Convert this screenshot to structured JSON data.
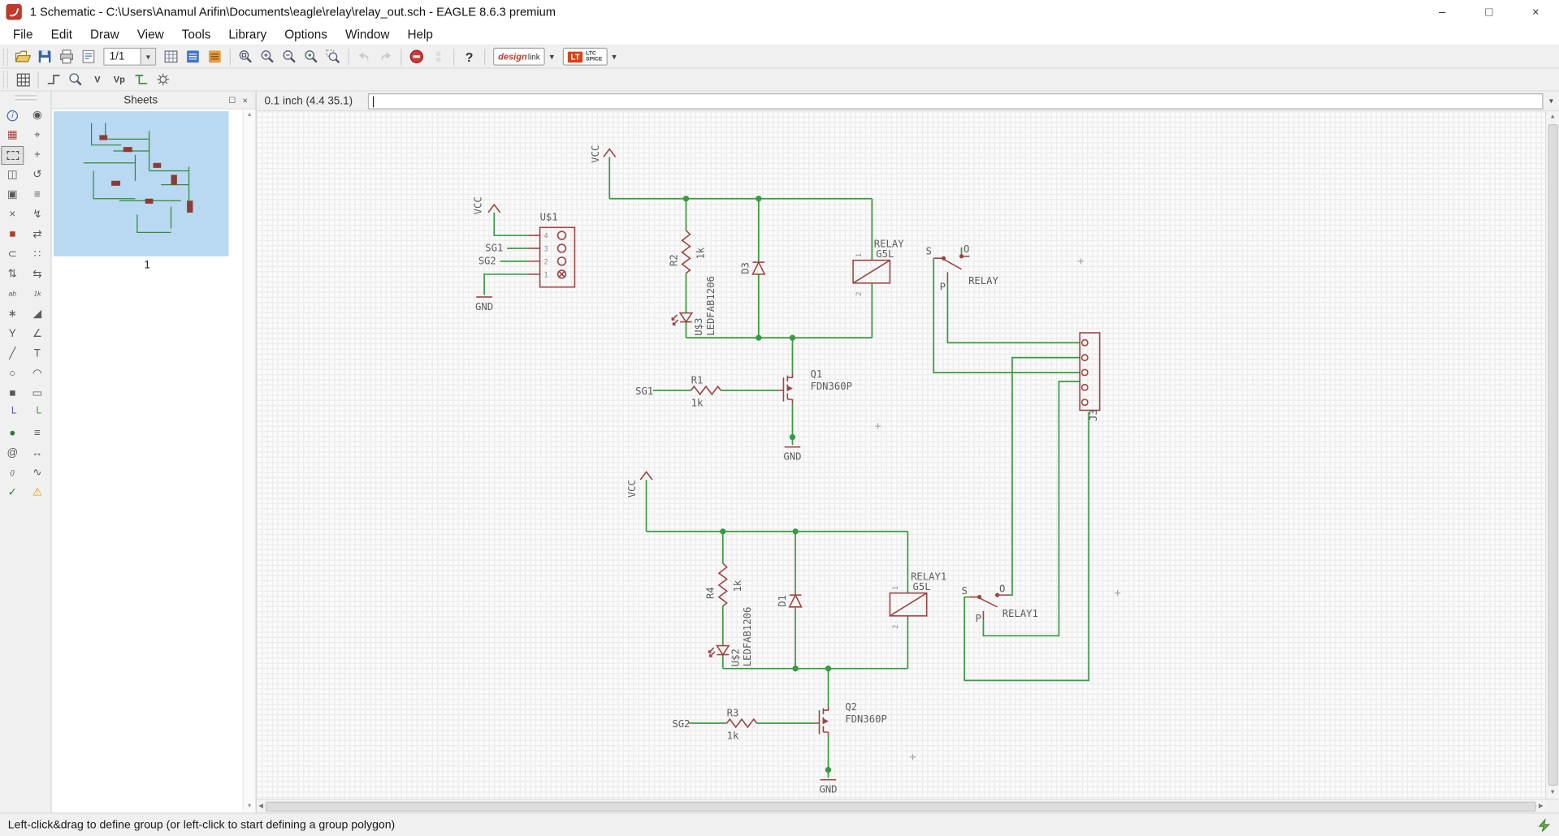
{
  "window": {
    "title": "1 Schematic - C:\\Users\\Anamul Arifin\\Documents\\eagle\\relay\\relay_out.sch - EAGLE 8.6.3 premium",
    "minimize": "–",
    "maximize": "□",
    "close": "×"
  },
  "menubar": {
    "items": [
      "File",
      "Edit",
      "Draw",
      "View",
      "Tools",
      "Library",
      "Options",
      "Window",
      "Help"
    ]
  },
  "toolbar1": {
    "zoom_level": "1/1",
    "dropdown_glyph": "▾",
    "help_glyph": "?",
    "designlink_line1": "design",
    "designlink_line2": "link",
    "ltspice_logo": "LT",
    "ltspice_line1": "LTC",
    "ltspice_line2": "SPICE"
  },
  "toolbar2": {
    "v_label": "V",
    "vp_label": "Vp"
  },
  "palette": {
    "icons": [
      {
        "name": "info",
        "glyph": "i",
        "css": "circled"
      },
      {
        "name": "show",
        "glyph": "◉"
      },
      {
        "name": "display",
        "glyph": "▦",
        "color": "#a8453f"
      },
      {
        "name": "mark",
        "glyph": "⌖"
      },
      {
        "name": "group",
        "glyph": "",
        "css": "dashedbox",
        "selected": true
      },
      {
        "name": "move",
        "glyph": "+"
      },
      {
        "name": "mirror",
        "glyph": "◫"
      },
      {
        "name": "rotate",
        "glyph": "↺"
      },
      {
        "name": "copy",
        "glyph": "▣"
      },
      {
        "name": "paste",
        "glyph": "≡"
      },
      {
        "name": "delete",
        "glyph": "×"
      },
      {
        "name": "change",
        "glyph": "↯"
      },
      {
        "name": "paint",
        "glyph": "■",
        "color": "#b23b32"
      },
      {
        "name": "replace",
        "glyph": "⇄"
      },
      {
        "name": "cut",
        "glyph": "⊂"
      },
      {
        "name": "invoke",
        "glyph": "∷"
      },
      {
        "name": "gateswap",
        "glyph": "⇅"
      },
      {
        "name": "pinswap",
        "glyph": "⇆"
      },
      {
        "name": "name",
        "glyph": "ab",
        "css": "nametag"
      },
      {
        "name": "value",
        "glyph": "1k",
        "css": "nametag"
      },
      {
        "name": "smash",
        "glyph": "∗"
      },
      {
        "name": "miter",
        "glyph": "◢"
      },
      {
        "name": "split",
        "glyph": "Y"
      },
      {
        "name": "optimize",
        "glyph": "∠"
      },
      {
        "name": "wire",
        "glyph": "╱"
      },
      {
        "name": "text",
        "glyph": "T"
      },
      {
        "name": "circle",
        "glyph": "○"
      },
      {
        "name": "arc",
        "glyph": "◠"
      },
      {
        "name": "rect",
        "glyph": "■"
      },
      {
        "name": "frame",
        "glyph": "▭"
      },
      {
        "name": "bus",
        "glyph": "└",
        "color": "#2b3faf"
      },
      {
        "name": "net",
        "glyph": "└",
        "color": "#2e7d32"
      },
      {
        "name": "junction",
        "glyph": "●",
        "color": "#2e7d32"
      },
      {
        "name": "label",
        "glyph": "≡"
      },
      {
        "name": "attribute",
        "glyph": "@"
      },
      {
        "name": "dimension",
        "glyph": "↔"
      },
      {
        "name": "braces",
        "glyph": "{}",
        "css": "nametag"
      },
      {
        "name": "probe",
        "glyph": "∿"
      },
      {
        "name": "erc",
        "glyph": "✓",
        "color": "#2e7d32"
      },
      {
        "name": "errors",
        "glyph": "⚠",
        "color": "#d7a000"
      }
    ]
  },
  "sheets": {
    "title": "Sheets",
    "float_glyph": "◻",
    "close_glyph": "×",
    "sheet_label": "1",
    "scroll_up": "▲",
    "scroll_down": "▼"
  },
  "coordbar": {
    "position": "0.1 inch (4.4 35.1)",
    "command_value": "",
    "dropdown_glyph": "▾"
  },
  "scrollbars": {
    "up": "▲",
    "down": "▼",
    "left": "◀",
    "right": "▶"
  },
  "statusbar": {
    "message": "Left-click&drag to define group (or left-click to start defining a group polygon)"
  },
  "sch": {
    "vcc": "VCC",
    "gnd": "GND",
    "sg1": "SG1",
    "sg2": "SG2",
    "u1": {
      "name": "U$1",
      "p4": "4",
      "p3": "3",
      "p2": "2",
      "p1": "1"
    },
    "r1": {
      "name": "R1",
      "value": "1k"
    },
    "r2": {
      "name": "R2",
      "value": "1k"
    },
    "r3": {
      "name": "R3",
      "value": "1k"
    },
    "r4": {
      "name": "R4",
      "value": "1k"
    },
    "d1": {
      "name": "D1"
    },
    "d3": {
      "name": "D3"
    },
    "u2": {
      "name": "U$2",
      "value": "LEDFAB1206"
    },
    "u3": {
      "name": "U$3",
      "value": "LEDFAB1206"
    },
    "q1": {
      "name": "Q1",
      "value": "FDN360P"
    },
    "q2": {
      "name": "Q2",
      "value": "FDN360P"
    },
    "relay": {
      "name": "RELAY",
      "value": "G5L",
      "p1": "1",
      "p2": "2"
    },
    "relay1": {
      "name": "RELAY1",
      "value": "G5L",
      "p1": "1",
      "p2": "2"
    },
    "contact": {
      "s": "S",
      "o": "O",
      "p": "P",
      "label": "RELAY"
    },
    "contact1": {
      "s": "S",
      "o": "O",
      "p": "P",
      "label": "RELAY1"
    },
    "j3": {
      "name": "J3"
    }
  }
}
